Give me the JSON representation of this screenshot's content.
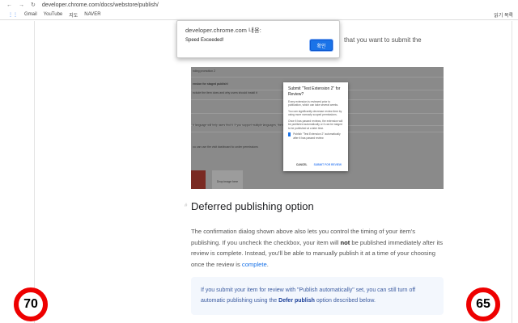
{
  "browser": {
    "url": "developer.chrome.com/docs/webstore/publish/",
    "bookmarks": [
      "Gmail",
      "YouTube",
      "지도",
      "NAVER"
    ],
    "reading_list": "읽기 목록"
  },
  "alert": {
    "origin": "developer.chrome.com 내용:",
    "message": "Speed Exceeded!",
    "ok": "확인"
  },
  "doc": {
    "intro_tail": "that you want to submit the",
    "screenshot": {
      "rows": [
        "nding promotion 2",
        "ension for staged publish!",
        "nclude the item does and why users should install it",
        "h language will help users find it. If you support multiple languages, then you can",
        "ou can use the visit dashboard to under permissions",
        "Drop image here"
      ],
      "dialog": {
        "title": "Submit \"Test Extension 2\" for Review?",
        "p1": "Every extension is reviewed prior to publication, which can take several weeks.",
        "p2": "You can significantly decrease review time by using more narrowly scoped permissions.",
        "p3": "Once it has passed reviews, the extension will be published automatically or it can be staged to be published at a later time.",
        "checkbox": "Publish \"Test Extension 2\" automatically after it has passed review",
        "cancel": "CANCEL",
        "submit": "SUBMIT FOR REVIEW"
      }
    },
    "heading": "Deferred publishing option",
    "hash": "#",
    "para": {
      "a": "The confirmation dialog shown above also lets you control the timing of your item's publishing. If you uncheck the checkbox, your item will ",
      "bold": "not",
      "b": " be published immediately after its review is complete. Instead, you'll be able to manually publish it at a time of your choosing once the review is ",
      "link": "complete",
      "c": "."
    },
    "note": {
      "a": "If you submit your item for review with \"Publish automatically\" set, you can still turn off ",
      "link": "automatic publishing",
      "b": " using the ",
      "bold": "Defer publish",
      "c": " option described below."
    }
  },
  "signs": {
    "left": "70",
    "right": "65"
  }
}
